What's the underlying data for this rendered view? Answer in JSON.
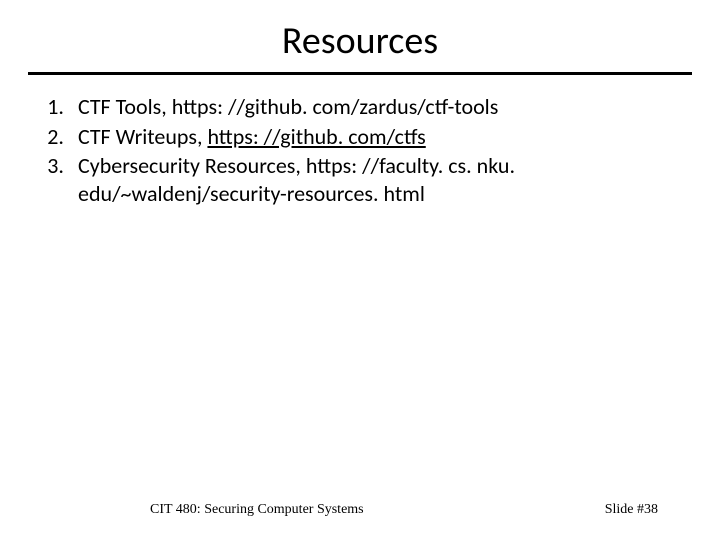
{
  "title": "Resources",
  "items": [
    {
      "num": "1.",
      "label": "CTF Tools, ",
      "url": "https: //github. com/zardus/ctf-tools",
      "link_decorated": false
    },
    {
      "num": "2.",
      "label": "CTF Writeups, ",
      "url": "https: //github. com/ctfs",
      "link_decorated": true
    },
    {
      "num": "3.",
      "label": "Cybersecurity Resources, ",
      "url": "https: //faculty. cs. nku. edu/~waldenj/security-resources. html",
      "link_decorated": false
    }
  ],
  "footer": {
    "left": "CIT 480: Securing Computer Systems",
    "right": "Slide #38"
  }
}
